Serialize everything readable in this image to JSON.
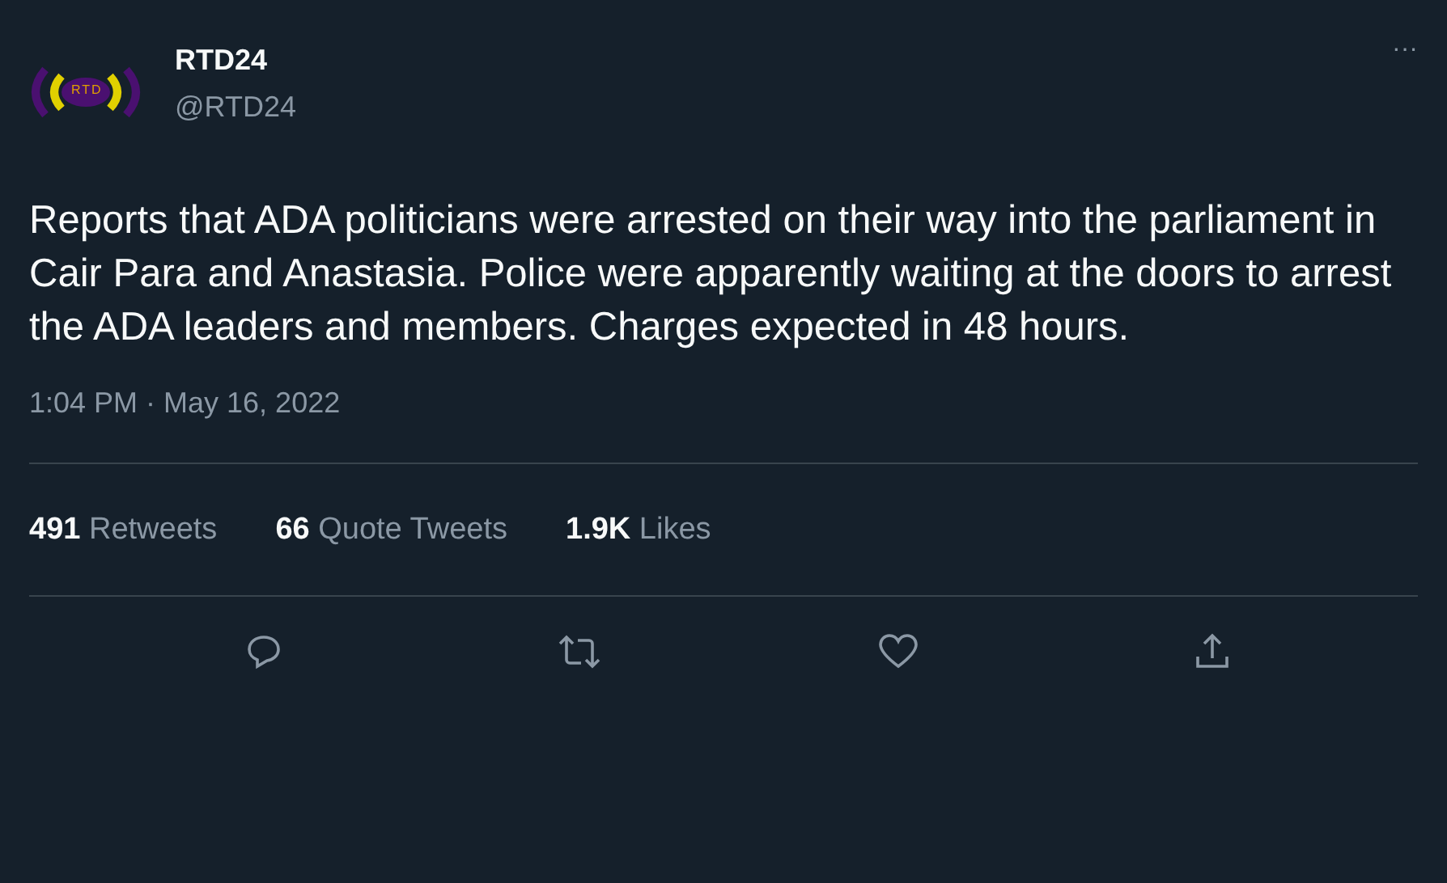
{
  "author": {
    "logo_text": "RTD",
    "name": "RTD24",
    "handle": "@RTD24"
  },
  "more": "···",
  "text": "Reports that ADA politicians were arrested on their way into the parliament in Cair Para and Anastasia. Police were apparently waiting at the doors to arrest the ADA leaders and members. Charges expected in 48 hours.",
  "timestamp": "1:04 PM · May 16, 2022",
  "stats": [
    {
      "count": "491",
      "label": "Retweets"
    },
    {
      "count": "66",
      "label": "Quote Tweets"
    },
    {
      "count": "1.9K",
      "label": "Likes"
    }
  ],
  "actions": [
    {
      "kind": "reply"
    },
    {
      "kind": "retweet"
    },
    {
      "kind": "like"
    },
    {
      "kind": "share"
    }
  ]
}
